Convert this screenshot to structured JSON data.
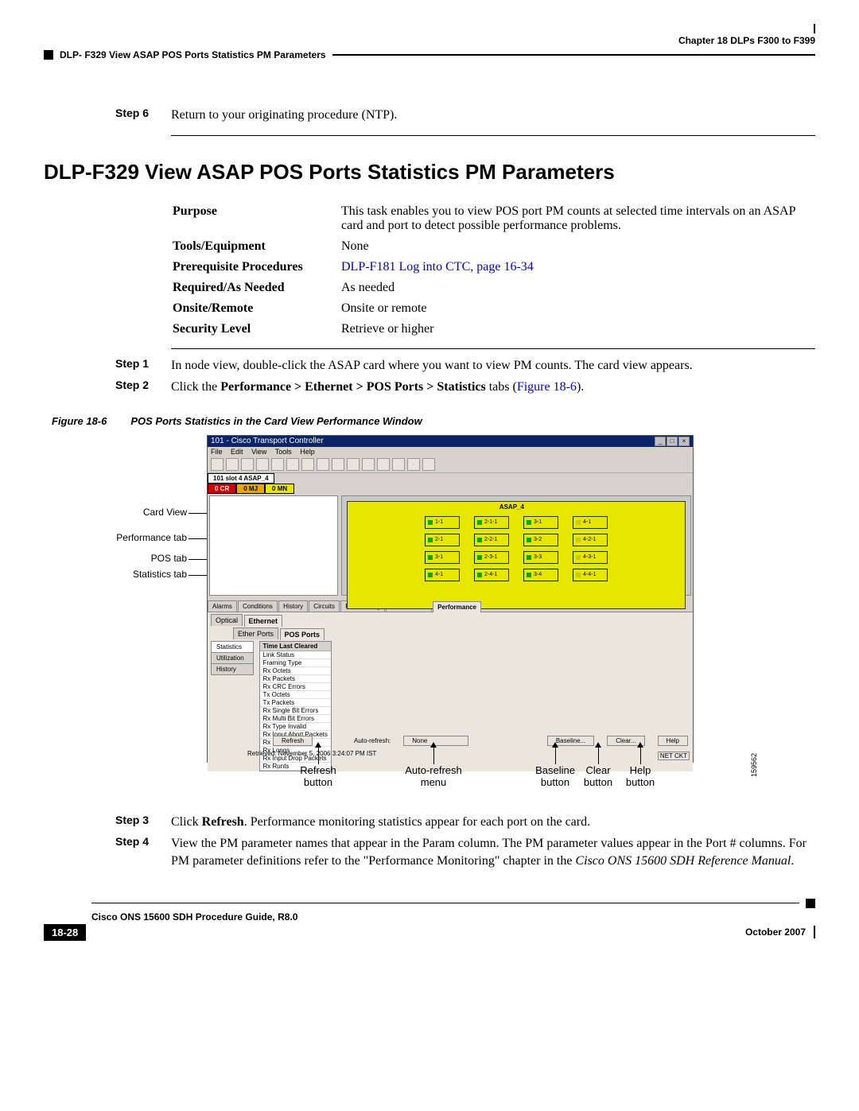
{
  "header": {
    "chapter": "Chapter 18 DLPs F300 to F399",
    "section": "DLP- F329 View ASAP POS Ports Statistics PM Parameters"
  },
  "pre_step": {
    "label": "Step 6",
    "text": "Return to your originating procedure (NTP)."
  },
  "title": "DLP-F329 View ASAP POS Ports Statistics PM Parameters",
  "meta": {
    "purpose_label": "Purpose",
    "purpose_text": "This task enables you to view POS port PM counts at selected time intervals on an ASAP card and port to detect possible performance problems.",
    "tools_label": "Tools/Equipment",
    "tools_text": "None",
    "prereq_label": "Prerequisite Procedures",
    "prereq_link": "DLP-F181 Log into CTC, page 16-34",
    "required_label": "Required/As Needed",
    "required_text": "As needed",
    "onsite_label": "Onsite/Remote",
    "onsite_text": "Onsite or remote",
    "security_label": "Security Level",
    "security_text": "Retrieve or higher"
  },
  "steps": {
    "s1_label": "Step 1",
    "s1_text": "In node view, double-click the ASAP card where you want to view PM counts. The card view appears.",
    "s2_label": "Step 2",
    "s2_pre": "Click the ",
    "s2_bold": "Performance > Ethernet > POS Ports > Statistics",
    "s2_post": " tabs (",
    "s2_link": "Figure 18-6",
    "s2_end": ").",
    "s3_label": "Step 3",
    "s3_pre": "Click ",
    "s3_bold": "Refresh",
    "s3_post": ". Performance monitoring statistics appear for each port on the card.",
    "s4_label": "Step 4",
    "s4_text": "View the PM parameter names that appear in the Param column. The PM parameter values appear in the Port # columns. For PM parameter definitions refer to the \"Performance Monitoring\" chapter in the ",
    "s4_ital": "Cisco ONS 15600 SDH Reference Manual",
    "s4_end": "."
  },
  "figure": {
    "num": "Figure 18-6",
    "caption": "POS Ports Statistics in the Card View Performance Window",
    "side_id": "159562",
    "callouts": {
      "card_view": "Card View",
      "perf_tab": "Performance tab",
      "pos_tab": "POS tab",
      "stats_tab": "Statistics tab",
      "refresh": "Refresh button",
      "auto": "Auto-refresh menu",
      "baseline": "Baseline button",
      "clear": "Clear button",
      "help": "Help button"
    },
    "window": {
      "title": "101 - Cisco Transport Controller",
      "menus": [
        "File",
        "Edit",
        "View",
        "Tools",
        "Help"
      ],
      "slot_name": "101 slot 4 ASAP_4",
      "alarm_cr": "0 CR",
      "alarm_mj": "0 MJ",
      "alarm_mn": "0 MN",
      "chassis_label": "ASAP_4",
      "ports_a": [
        "1-1",
        "2-1",
        "3-1",
        "4-1"
      ],
      "ports_b": [
        "2-1-1",
        "2-2-1",
        "2-3-1",
        "2-4-1"
      ],
      "ports_c": [
        "3-1",
        "3-2",
        "3-3",
        "3-4"
      ],
      "ports_d": [
        "4-1",
        "4-2-1",
        "4-3-1",
        "4-4-1"
      ],
      "main_tabs": [
        "Alarms",
        "Conditions",
        "History",
        "Circuits",
        "Provisioning",
        "Maintenance",
        "Performance"
      ],
      "sub_top": [
        "Optical",
        "Ethernet"
      ],
      "sub_mid": [
        "Ether Ports",
        "POS Ports"
      ],
      "vtabs": [
        "Statistics",
        "Utilization",
        "History"
      ],
      "grid_header": "Time Last Cleared",
      "grid_rows": [
        "Link Status",
        "Framing Type",
        "Rx Octets",
        "Rx Packets",
        "Rx CRC Errors",
        "Tx Octets",
        "Tx Packets",
        "Rx Single Bit Errors",
        "Rx Multi Bit Errors",
        "Rx Type Invalid",
        "Rx Input Abort Packets",
        "Rx Shorts",
        "Rx Longs",
        "Rx Input Drop Packets",
        "Rx Runts"
      ],
      "btn_refresh": "Refresh",
      "auto_label": "Auto-refresh:",
      "auto_value": "None",
      "btn_baseline": "Baseline...",
      "btn_clear": "Clear...",
      "btn_help": "Help",
      "retrieved": "Retrieved: November 5, 2006 3:24:07 PM IST",
      "netcnt": "NET CKT"
    }
  },
  "footer": {
    "guide": "Cisco ONS 15600 SDH Procedure Guide, R8.0",
    "page": "18-28",
    "date": "October 2007"
  }
}
